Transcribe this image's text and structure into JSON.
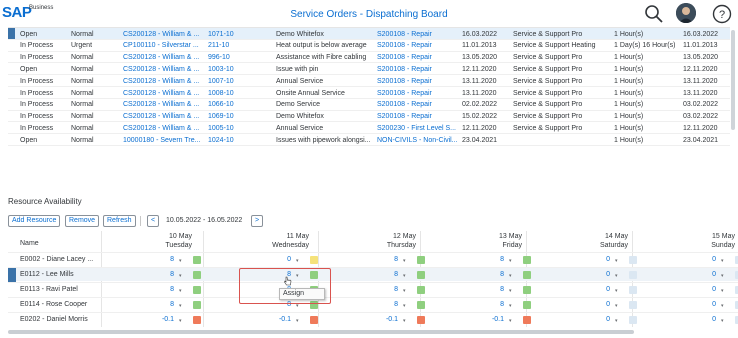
{
  "shell": {
    "brand": "SAP",
    "brand_suffix": "Business",
    "title": "Service Orders - Dispatching Board"
  },
  "orders": [
    {
      "status": "Open",
      "priority": "Normal",
      "customer": "CS200128 - William & ...",
      "object": "1071-10",
      "desc": "Demo Whitefox",
      "type": "S200108 - Repair",
      "date": "16.03.2022",
      "team": "Service & Support Pro",
      "duration": "1 Hour(s)",
      "end": "16.03.2022",
      "selected": true
    },
    {
      "status": "In Process",
      "priority": "Urgent",
      "customer": "CP100110 - Silverstar ...",
      "object": "211-10",
      "desc": "Heat output is below average",
      "type": "S200108 - Repair",
      "date": "11.01.2013",
      "team": "Service & Support Heating",
      "duration": "1 Day(s) 16 Hour(s)",
      "end": "11.01.2013"
    },
    {
      "status": "In Process",
      "priority": "Normal",
      "customer": "CS200128 - William & ...",
      "object": "996-10",
      "desc": "Assistance with Fibre cabling",
      "type": "S200108 - Repair",
      "date": "13.05.2020",
      "team": "Service & Support Pro",
      "duration": "1 Hour(s)",
      "end": "13.05.2020"
    },
    {
      "status": "Open",
      "priority": "Normal",
      "customer": "CS200128 - William & ...",
      "object": "1003-10",
      "desc": "Issue with pin",
      "type": "S200108 - Repair",
      "date": "12.11.2020",
      "team": "Service & Support Pro",
      "duration": "1 Hour(s)",
      "end": "12.11.2020"
    },
    {
      "status": "In Process",
      "priority": "Normal",
      "customer": "CS200128 - William & ...",
      "object": "1007-10",
      "desc": "Annual Service",
      "type": "S200108 - Repair",
      "date": "13.11.2020",
      "team": "Service & Support Pro",
      "duration": "1 Hour(s)",
      "end": "13.11.2020"
    },
    {
      "status": "In Process",
      "priority": "Normal",
      "customer": "CS200128 - William & ...",
      "object": "1008-10",
      "desc": "Onsite Annual Service",
      "type": "S200108 - Repair",
      "date": "13.11.2020",
      "team": "Service & Support Pro",
      "duration": "1 Hour(s)",
      "end": "13.11.2020"
    },
    {
      "status": "In Process",
      "priority": "Normal",
      "customer": "CS200128 - William & ...",
      "object": "1066-10",
      "desc": "Demo Service",
      "type": "S200108 - Repair",
      "date": "02.02.2022",
      "team": "Service & Support Pro",
      "duration": "1 Hour(s)",
      "end": "03.02.2022"
    },
    {
      "status": "In Process",
      "priority": "Normal",
      "customer": "CS200128 - William & ...",
      "object": "1069-10",
      "desc": "Demo Whitefox",
      "type": "S200108 - Repair",
      "date": "15.02.2022",
      "team": "Service & Support Pro",
      "duration": "1 Hour(s)",
      "end": "03.02.2022"
    },
    {
      "status": "In Process",
      "priority": "Normal",
      "customer": "CS200128 - William & ...",
      "object": "1005-10",
      "desc": "Annual Service",
      "type": "S200230 - First Level S...",
      "date": "12.11.2020",
      "team": "Service & Support Pro",
      "duration": "1 Hour(s)",
      "end": "12.11.2020"
    },
    {
      "status": "Open",
      "priority": "Normal",
      "customer": "10000180 - Severn Tre...",
      "object": "1024-10",
      "desc": "Issues with pipework alongsi...",
      "type": "NON-CIVILS - Non-Civil...",
      "date": "23.04.2021",
      "team": "",
      "duration": "1 Hour(s)",
      "end": "23.04.2021"
    }
  ],
  "resource": {
    "title": "Resource Availability",
    "buttons": {
      "add": "Add Resource",
      "remove": "Remove",
      "refresh": "Refresh",
      "prev": "<",
      "next": ">"
    },
    "range": "10.05.2022 - 16.05.2022",
    "name_header": "Name",
    "days": [
      {
        "date": "10 May",
        "weekday": "Tuesday"
      },
      {
        "date": "11 May",
        "weekday": "Wednesday"
      },
      {
        "date": "12 May",
        "weekday": "Thursday"
      },
      {
        "date": "13 May",
        "weekday": "Friday"
      },
      {
        "date": "14 May",
        "weekday": "Saturday"
      },
      {
        "date": "15 May",
        "weekday": "Sunday"
      }
    ],
    "rows": [
      {
        "name": "E0002 - Diane Lacey ...",
        "values": [
          "8",
          "0",
          "8",
          "8",
          "0",
          "0"
        ],
        "status": [
          "green",
          "yellow",
          "green",
          "green",
          "empty",
          "empty"
        ]
      },
      {
        "name": "E0112 - Lee Mills",
        "values": [
          "8",
          "8",
          "8",
          "8",
          "0",
          "0"
        ],
        "status": [
          "green",
          "green",
          "green",
          "green",
          "empty",
          "empty"
        ],
        "selected": true
      },
      {
        "name": "E0113 - Ravi Patel",
        "values": [
          "8",
          "8",
          "8",
          "8",
          "0",
          "0"
        ],
        "status": [
          "green",
          "green",
          "green",
          "green",
          "empty",
          "empty"
        ]
      },
      {
        "name": "E0114 - Rose Cooper",
        "values": [
          "8",
          "8",
          "8",
          "8",
          "0",
          "0"
        ],
        "status": [
          "green",
          "green",
          "green",
          "green",
          "empty",
          "empty"
        ]
      },
      {
        "name": "E0202 - Daniel Morris",
        "values": [
          "-0.1",
          "-0.1",
          "-0.1",
          "-0.1",
          "0",
          "0"
        ],
        "status": [
          "red",
          "red",
          "red",
          "red",
          "empty",
          "empty"
        ]
      }
    ],
    "context_menu": {
      "assign": "Assign"
    },
    "colors": {
      "green": "#8fcf7f",
      "yellow": "#f5e27a",
      "red": "#ef7a5a",
      "empty": "#dbe7f2"
    }
  }
}
